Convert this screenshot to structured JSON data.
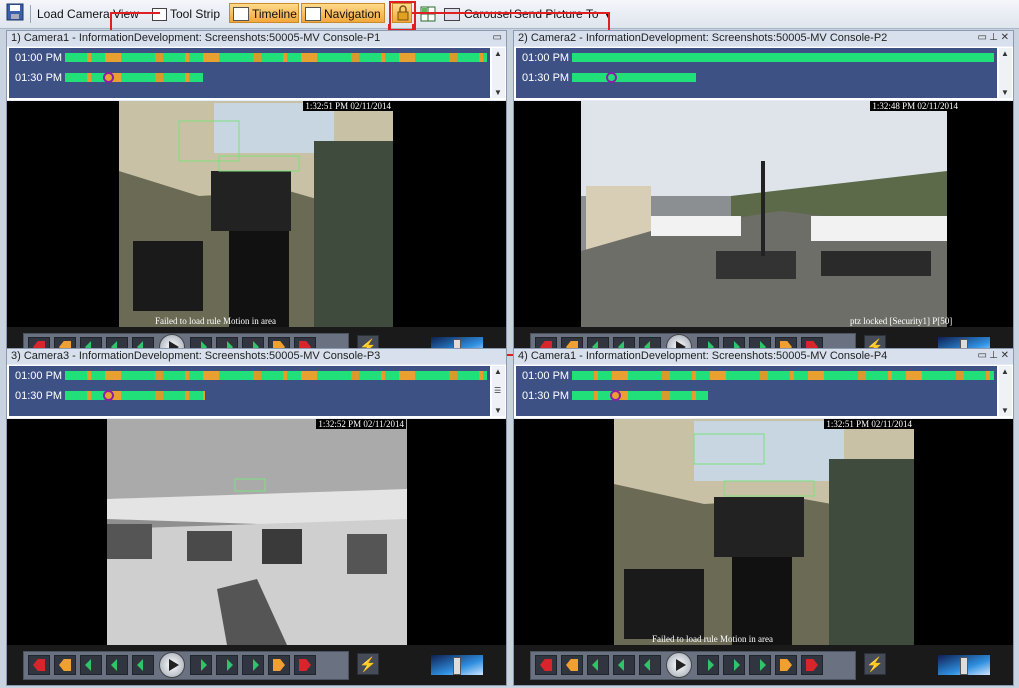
{
  "toolbar": {
    "load_camera_view": "Load Camera View",
    "tool_strip": "Tool Strip",
    "timeline": "Timeline",
    "navigation": "Navigation",
    "carousel": "Carousel",
    "send_picture_to": "Send Picture To",
    "icons": [
      "save-icon",
      "tool-strip-icon",
      "timeline-icon",
      "navigation-icon",
      "lock-icon",
      "grid-icon",
      "carousel-icon"
    ]
  },
  "panels": [
    {
      "title": "1) Camera1 - InformationDevelopment: Screenshots:50005-MV Console-P1",
      "timeline_rows": [
        "01:00 PM",
        "01:30 PM"
      ],
      "timestamp": "1:32:51 PM 02/11/2014",
      "message": "Failed to load rule Motion in area"
    },
    {
      "title": "2) Camera2 - InformationDevelopment: Screenshots:50005-MV Console-P2",
      "timeline_rows": [
        "01:00 PM",
        "01:30 PM"
      ],
      "timestamp": "1:32:48 PM 02/11/2014",
      "message": "ptz locked [Security1] P[50]"
    },
    {
      "title": "3) Camera3 - InformationDevelopment: Screenshots:50005-MV Console-P3",
      "timeline_rows": [
        "01:00 PM",
        "01:30 PM"
      ],
      "timestamp": "1:32:52 PM 02/11/2014",
      "message": ""
    },
    {
      "title": "4) Camera1 - InformationDevelopment: Screenshots:50005-MV Console-P4",
      "timeline_rows": [
        "01:00 PM",
        "01:30 PM"
      ],
      "timestamp": "1:32:51 PM 02/11/2014",
      "message": "Failed to load rule Motion in area"
    }
  ],
  "colors": {
    "timeline_bg": "#3d5184",
    "recording_green": "#21e07a",
    "event_orange": "#e89a2a",
    "highlight_red": "#e02020",
    "marker_purple": "#8a1fa8"
  }
}
